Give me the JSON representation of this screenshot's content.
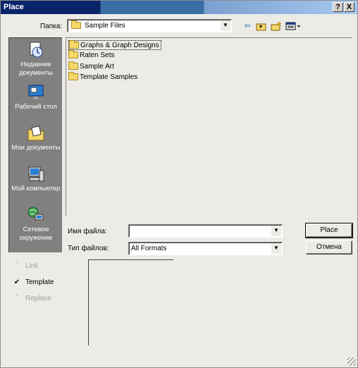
{
  "window": {
    "title": "Place",
    "help_label": "?",
    "close_label": "X"
  },
  "lookin": {
    "label": "Папка:",
    "value": "Sample Files"
  },
  "toolbar": {
    "icons": [
      "back-icon",
      "up-folder-icon",
      "new-folder-icon",
      "view-menu-icon"
    ]
  },
  "places": [
    {
      "label": "Недавние документы",
      "icon": "recent-documents-icon"
    },
    {
      "label": "Рабочий стол",
      "icon": "desktop-icon"
    },
    {
      "label": "Мои документы",
      "icon": "my-documents-icon"
    },
    {
      "label": "Мой компьютер",
      "icon": "my-computer-icon"
    },
    {
      "label": "Сетевое окружение",
      "icon": "network-icon"
    }
  ],
  "files": [
    {
      "name": "Graphs & Graph Designs",
      "selected": true
    },
    {
      "name": "Raten Sets",
      "selected": false
    },
    {
      "name": "Sample Art",
      "selected": false
    },
    {
      "name": "Template Samples",
      "selected": false
    }
  ],
  "filename": {
    "label": "Имя файла:",
    "value": ""
  },
  "filetype": {
    "label": "Тип файлов:",
    "value": "All Formats"
  },
  "buttons": {
    "place": "Place",
    "cancel": "Отмена"
  },
  "options": [
    {
      "label": "Link",
      "checked": false,
      "enabled": false
    },
    {
      "label": "Template",
      "checked": true,
      "enabled": true
    },
    {
      "label": "Replace",
      "checked": false,
      "enabled": false
    }
  ],
  "colors": {
    "title_dark": "#0a246a",
    "dialog_bg": "#ecebe6",
    "places_bg": "#808080"
  }
}
